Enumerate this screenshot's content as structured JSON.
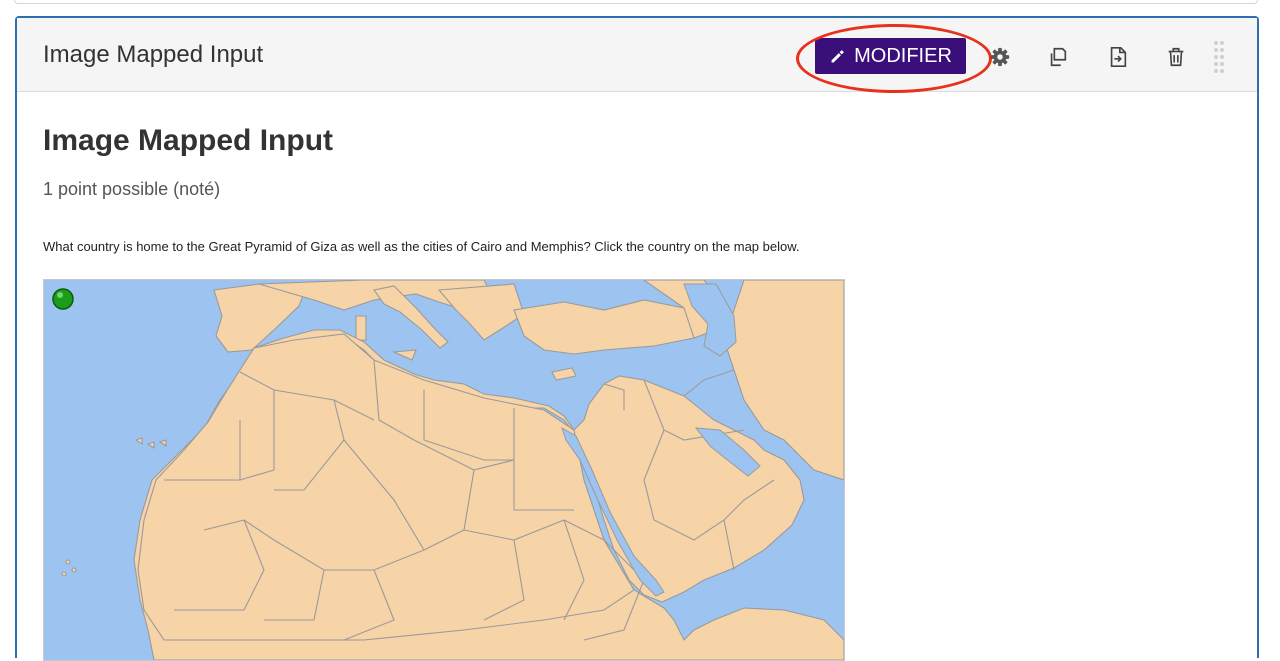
{
  "header": {
    "title": "Image Mapped Input",
    "edit_label": "MODIFIER"
  },
  "toolbar_icons": [
    "pencil-icon",
    "gear-icon",
    "duplicate-icon",
    "move-icon",
    "trash-icon",
    "drag-handle-icon"
  ],
  "problem": {
    "title": "Image Mapped Input",
    "points": "1 point possible (noté)",
    "question": "What country is home to the Great Pyramid of Giza as well as the cities of Cairo and Memphis? Click the country on the map below."
  },
  "map": {
    "sea_color": "#9dc4f0",
    "land_color": "#f7d3a8",
    "border_color": "#9a9a9a",
    "marker_color": "#1a9e1a"
  },
  "colors": {
    "accent": "#3b0f7a",
    "card_border": "#2e6fb0",
    "highlight": "#e8301c"
  }
}
